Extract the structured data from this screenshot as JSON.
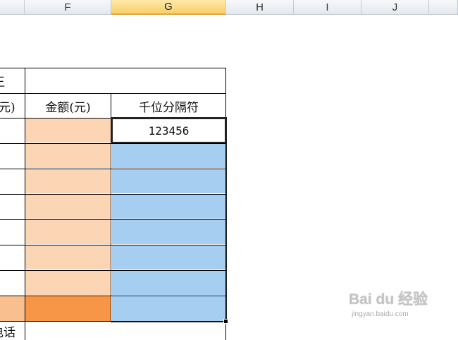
{
  "columns": [
    "F",
    "G",
    "H",
    "I",
    "J"
  ],
  "selected_column": "G",
  "headers": {
    "partial_e_top": "王",
    "partial_e_header": "元)",
    "amount_header": "金额(元)",
    "thousands_header": "千位分隔符"
  },
  "cells": {
    "g_first_value": "123456",
    "partial_bottom_label": "电话"
  },
  "colors": {
    "light_orange": "#fcd5b4",
    "dark_orange": "#f79646",
    "medium_orange": "#fabf8f",
    "selection_blue": "#a6cef0",
    "selected_header": "#f7cf6c"
  },
  "watermark": {
    "logo": "Bai du 经验",
    "url": "jingyan.baidu.com"
  }
}
